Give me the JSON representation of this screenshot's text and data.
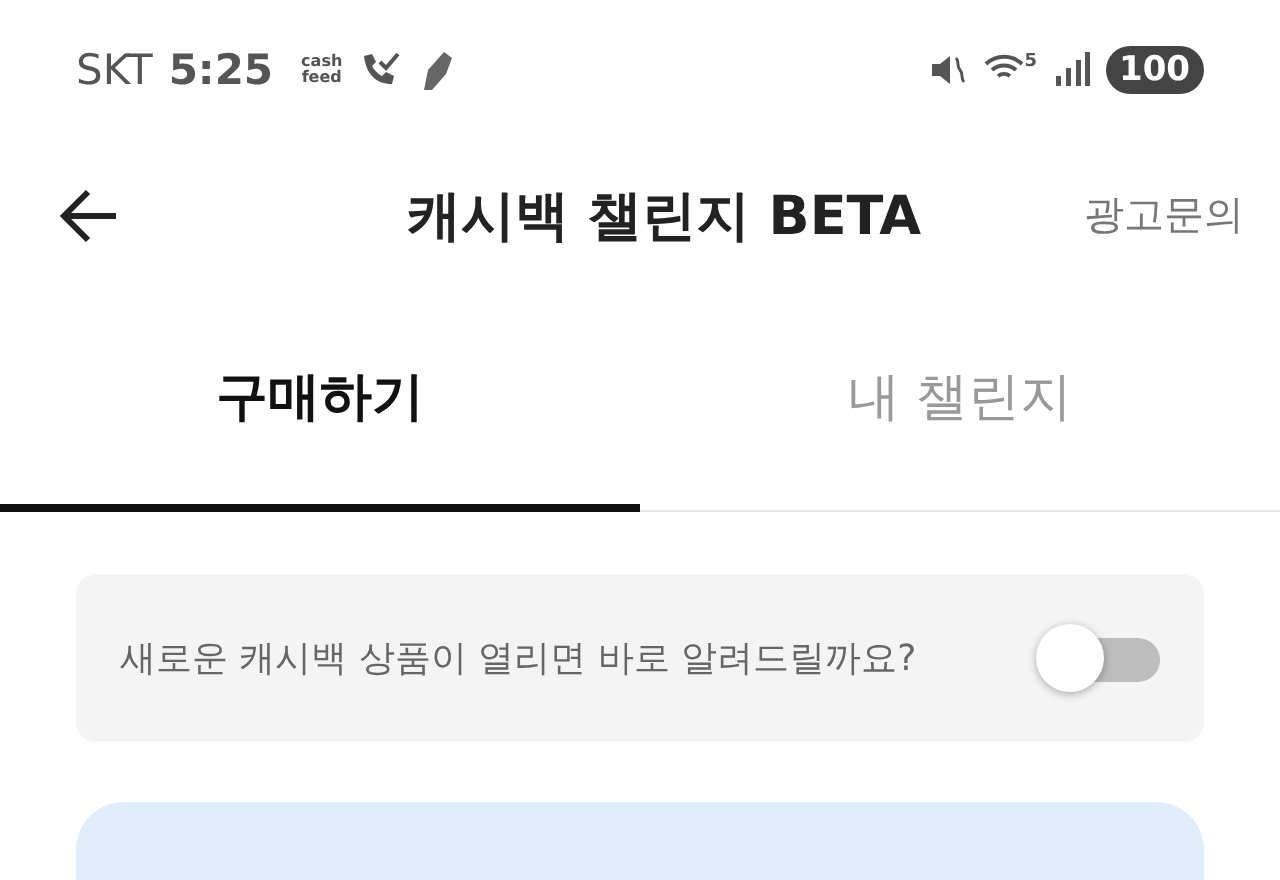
{
  "status_bar": {
    "carrier": "SKT",
    "time": "5:25",
    "app_badge": [
      "cash",
      "feed"
    ],
    "network": "5",
    "battery": "100"
  },
  "header": {
    "title": "캐시백 챌린지 BETA",
    "action": "광고문의"
  },
  "tabs": [
    {
      "label": "구매하기",
      "selected": true
    },
    {
      "label": "내 챌린지",
      "selected": false
    }
  ],
  "notice": {
    "text": "새로운 캐시백 상품이 열리면 바로 알려드릴까요?",
    "on": false
  }
}
